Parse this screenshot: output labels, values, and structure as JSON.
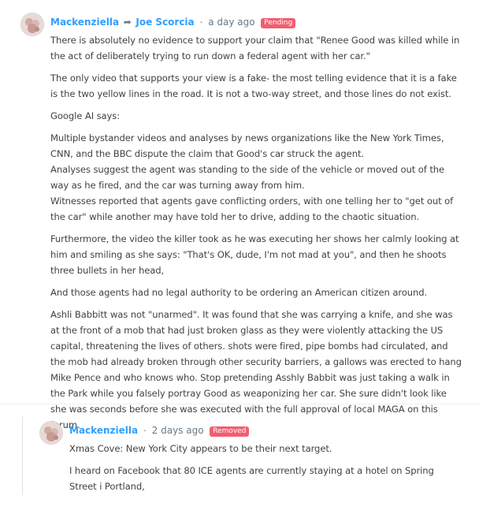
{
  "comment_1": {
    "author": "Mackenziella",
    "reply_to": "Joe Scorcia",
    "time": "a day ago",
    "status": "Pending",
    "status_color": "#f05f70",
    "paragraphs": [
      "There is absolutely no evidence to support your claim that \"Renee Good was killed while in the act of deliberately trying to run down a federal agent with her car.\"",
      "The only video that supports your view is a fake- the most telling evidence that it is a fake is the two yellow lines in the road. It is not a two-way street, and those lines do not exist.",
      "Google AI says:",
      "Multiple bystander videos and analyses by news organizations like the New York Times, CNN, and the BBC dispute the claim that Good's car struck the agent.",
      "Analyses suggest the agent was standing to the side of the vehicle or moved out of the way as he fired, and the car was turning away from him.",
      "Witnesses reported that agents gave conflicting orders, with one telling her to \"get out of the car\" while another may have told her to drive, adding to the chaotic situation.",
      "Furthermore, the video the killer took as he was executing her shows her calmly looking at him and smiling as she says: \"That's OK, dude, I'm not mad at you\", and then he shoots three bullets in her head,",
      "And those agents had no legal authority to be ordering an American citizen around.",
      "Ashli Babbitt was not \"unarmed\". It was found that she was carrying a knife, and she was at the front of a mob that had just broken glass as they were violently attacking the US capital, threatening the lives of others. shots were fired, pipe bombs had circulated, and the mob had already broken through other security barriers, a gallows was erected to hang Mike Pence and who knows who. Stop pretending Asshly Babbit was just taking a walk in the Park while you falsely portray Good as weaponizing her car. She sure didn't look like she was seconds before she was executed with the full approval of local MAGA on this forum."
    ]
  },
  "comment_2": {
    "author": "Mackenziella",
    "time": "2 days ago",
    "status": "Removed",
    "status_color": "#f05f70",
    "paragraphs": [
      "Xmas Cove: New York City appears to be their next target.",
      "I heard on Facebook that 80 ICE agents are currently staying at a hotel on Spring Street i Portland,"
    ]
  },
  "icons": {
    "reply_arrow": "reply-arrow-icon",
    "avatar": "user-avatar"
  },
  "colors": {
    "link": "#2e9fff",
    "meta": "#687a86",
    "text": "#3d4347"
  }
}
